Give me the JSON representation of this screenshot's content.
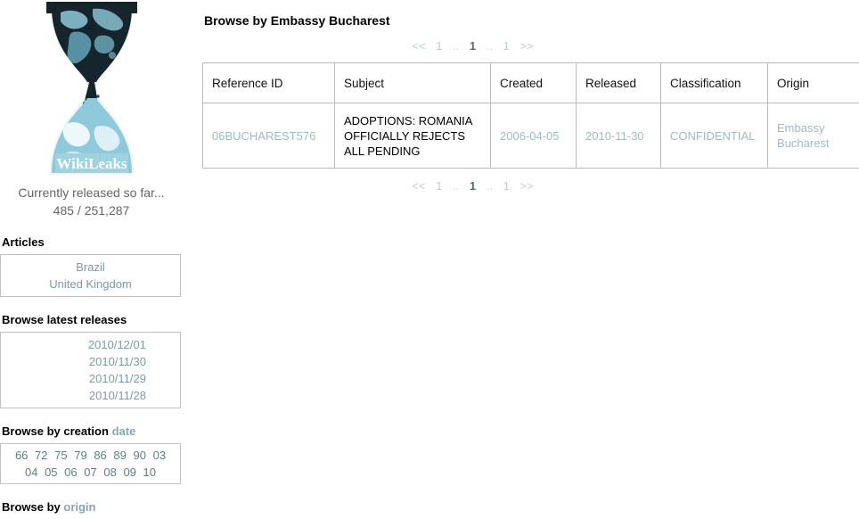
{
  "site": {
    "logo_wordmark": "WikiLeaks",
    "released_label": "Currently released so far...",
    "released_count": "485 / 251,287"
  },
  "sidebar": {
    "articles": {
      "heading": "Articles",
      "links": [
        "Brazil",
        "United Kingdom"
      ]
    },
    "latest_releases": {
      "heading": "Browse latest releases",
      "links": [
        "2010/12/01",
        "2010/11/30",
        "2010/11/29",
        "2010/11/28"
      ]
    },
    "creation_date": {
      "heading_static": "Browse by creation",
      "heading_link": "date",
      "years": [
        "66",
        "72",
        "75",
        "79",
        "86",
        "89",
        "90",
        "03",
        "04",
        "05",
        "06",
        "07",
        "08",
        "09",
        "10"
      ]
    },
    "origin": {
      "heading_static": "Browse by",
      "heading_link": "origin"
    }
  },
  "main": {
    "title": "Browse by Embassy Bucharest",
    "pagination": {
      "first": "<<",
      "prev_page": "1",
      "sep": "..",
      "current": "1",
      "next_page": "1",
      "last": ">>"
    },
    "table": {
      "columns": [
        "Reference ID",
        "Subject",
        "Created",
        "Released",
        "Classification",
        "Origin"
      ],
      "rows": [
        {
          "reference_id": "06BUCHAREST576",
          "subject": "ADOPTIONS: ROMANIA OFFICIALLY REJECTS ALL PENDING",
          "created": "2006-04-05",
          "released": "2010-11-30",
          "classification": "CONFIDENTIAL",
          "origin": "Embassy Bucharest"
        }
      ]
    }
  },
  "colors": {
    "link_blue": "#9dbbc4",
    "heading_black": "#000000",
    "logo_dark": "#16252b",
    "logo_light": "#8fc9dc",
    "table_border": "#bbbbbb"
  }
}
